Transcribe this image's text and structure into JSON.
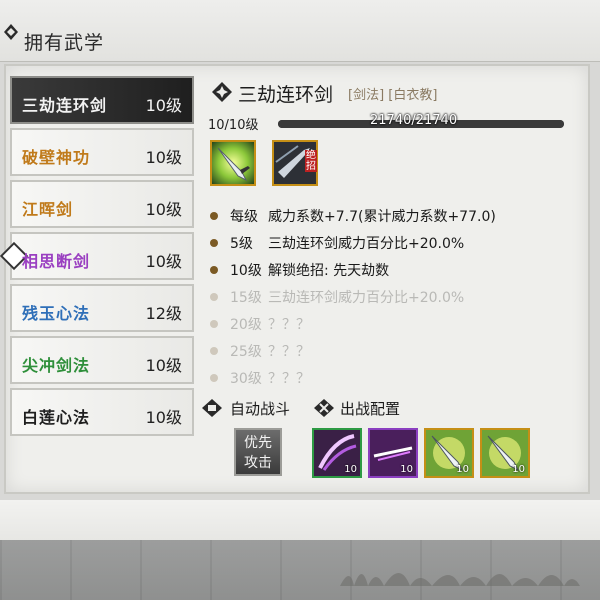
{
  "header": {
    "title": "拥有武学"
  },
  "skills": [
    {
      "name": "三劫连环剑",
      "level": "10级",
      "color": "#f2f2f2",
      "active": true
    },
    {
      "name": "破壁神功",
      "level": "10级",
      "color": "#c07a1a",
      "active": false
    },
    {
      "name": "江晖剑",
      "level": "10级",
      "color": "#c07a1a",
      "active": false
    },
    {
      "name": "相思断剑",
      "level": "10级",
      "color": "#9a3fc1",
      "active": false
    },
    {
      "name": "残玉心法",
      "level": "12级",
      "color": "#2f6fb8",
      "active": false
    },
    {
      "name": "尖冲剑法",
      "level": "10级",
      "color": "#2e8f3a",
      "active": false
    },
    {
      "name": "白莲心法",
      "level": "10级",
      "color": "#1f1f1f",
      "active": false
    }
  ],
  "detail": {
    "name": "三劫连环剑",
    "tags": "[剑法] [白衣教]",
    "level_text": "10/10级",
    "exp_text": "21740/21740",
    "exp_progress": 1.0,
    "ultimate_tag": "绝招",
    "effects": [
      {
        "level": "每级",
        "text": "威力系数+7.7(累计威力系数+77.0)",
        "unlocked": true
      },
      {
        "level": "5级",
        "text": "三劫连环剑威力百分比+20.0%",
        "unlocked": true
      },
      {
        "level": "10级",
        "text": "解锁绝招:  先天劫数",
        "unlocked": true
      },
      {
        "level": "15级",
        "text": "三劫连环剑威力百分比+20.0%",
        "unlocked": false
      },
      {
        "level": "20级",
        "text": "？？？",
        "unlocked": false
      },
      {
        "level": "25级",
        "text": "？？？",
        "unlocked": false
      },
      {
        "level": "30级",
        "text": "？？？",
        "unlocked": false
      }
    ]
  },
  "battle": {
    "auto_label": "自动战斗",
    "config_label": "出战配置",
    "priority_line1": "优先",
    "priority_line2": "攻击",
    "slots": [
      {
        "level": "10",
        "border": "#2e9a44",
        "icon": "purple-slash-icon"
      },
      {
        "level": "10",
        "border": "#8b3fc0",
        "icon": "purple-sword-icon"
      },
      {
        "level": "10",
        "border": "#c58f16",
        "icon": "sword-strike-icon"
      },
      {
        "level": "10",
        "border": "#c58f16",
        "icon": "sword-strike-icon"
      }
    ]
  }
}
